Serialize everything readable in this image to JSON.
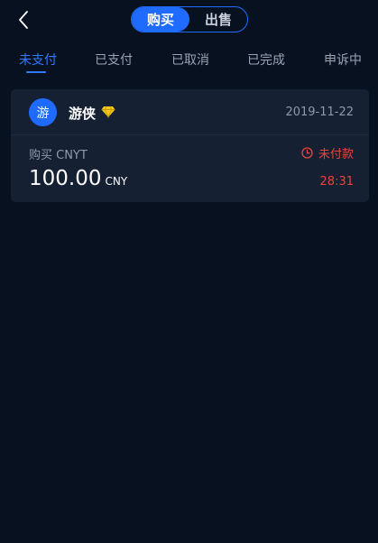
{
  "header": {
    "back_icon": "chevron-left-icon",
    "segments": [
      {
        "label": "购买",
        "active": true
      },
      {
        "label": "出售",
        "active": false
      }
    ],
    "accent_color": "#1f6bff"
  },
  "tabs": [
    {
      "label": "未支付",
      "active": true
    },
    {
      "label": "已支付",
      "active": false
    },
    {
      "label": "已取消",
      "active": false
    },
    {
      "label": "已完成",
      "active": false
    },
    {
      "label": "申诉中",
      "active": false
    }
  ],
  "orders": [
    {
      "avatar_char": "游",
      "username": "游侠",
      "badge_icon": "diamond-icon",
      "date": "2019-11-22",
      "trade_label": "购买 CNYT",
      "status_icon": "clock-icon",
      "status": "未付款",
      "amount": "100.00",
      "currency": "CNY",
      "countdown": "28:31"
    }
  ],
  "colors": {
    "background": "#08111f",
    "card": "#152033",
    "status_red": "#e8453c",
    "badge_gold": "#f5c518"
  }
}
